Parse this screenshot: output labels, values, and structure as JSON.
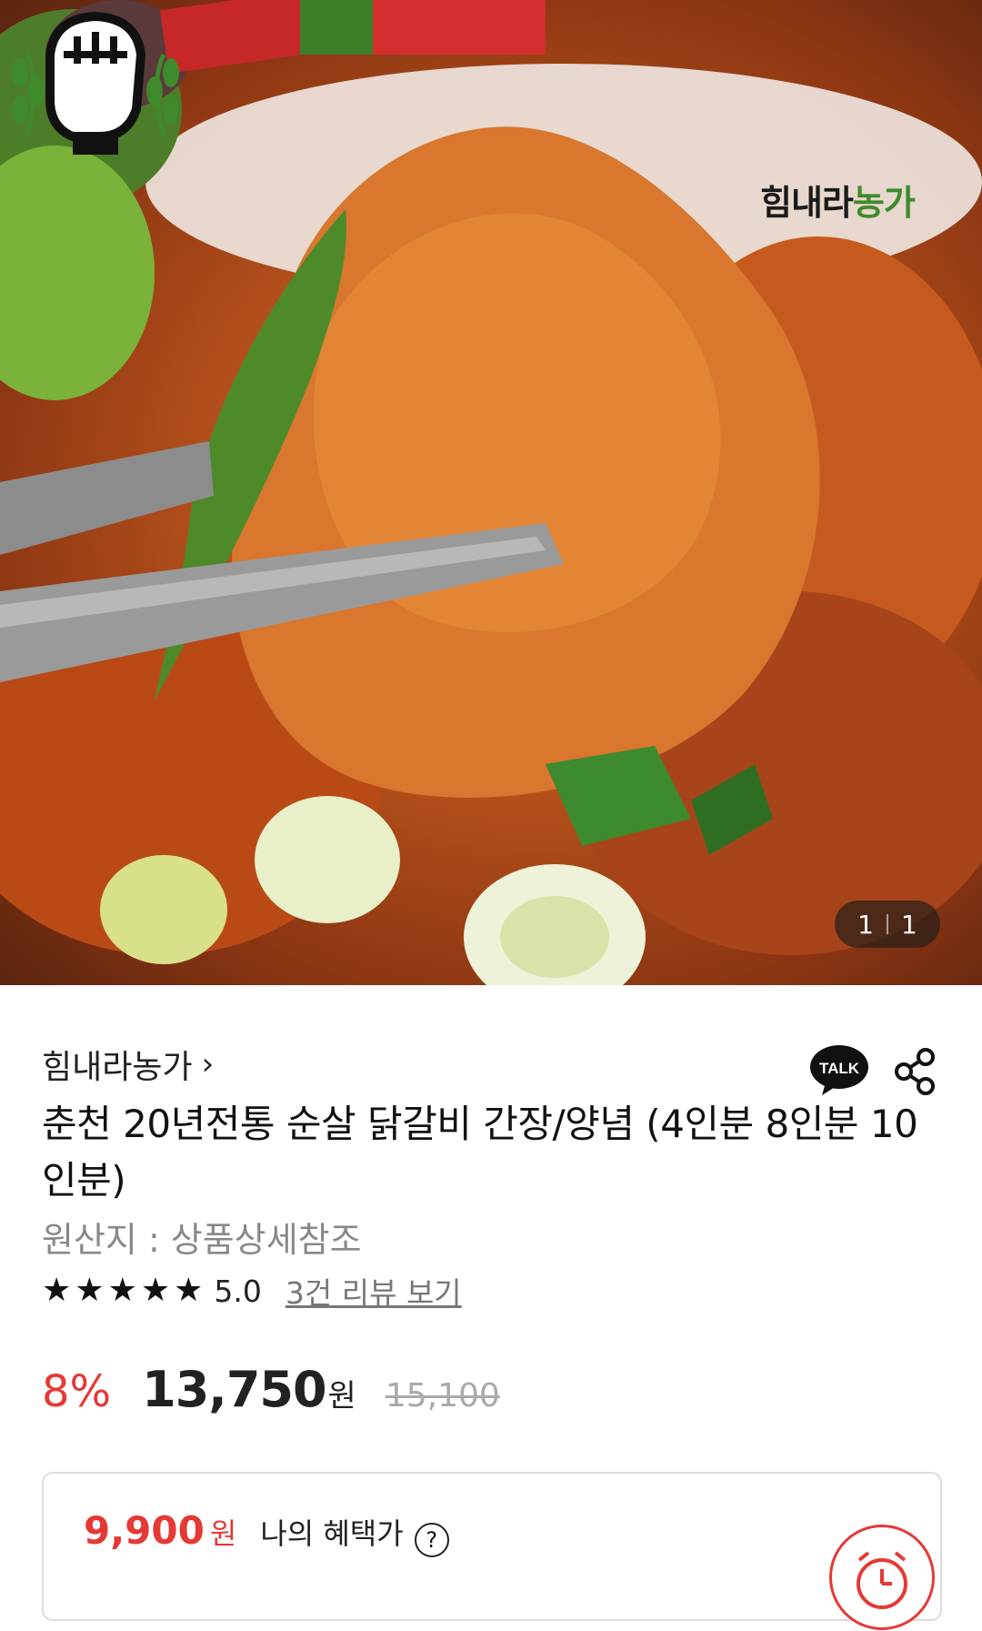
{
  "hero": {
    "counter_current": "1",
    "counter_total": "1",
    "logo_text_dark": "힘내라",
    "logo_text_green": "농가"
  },
  "product": {
    "store_name": "힘내라농가",
    "store_chevron": "›",
    "title": "춘천 20년전통 순살 닭갈비 간장/양념 (4인분 8인분 10인분)",
    "origin": "원산지 : 상품상세참조",
    "rating_score": "5.0",
    "reviews_link": "3건 리뷰 보기",
    "discount": "8%",
    "price": "13,750",
    "currency": "원",
    "original_price": "15,100"
  },
  "benefit": {
    "price": "9,900",
    "currency": "원",
    "label": "나의 혜택가",
    "help": "?"
  },
  "talk_label": "TALK",
  "colors": {
    "accent_red": "#e53935",
    "logo_green": "#3f8a2a"
  },
  "icons": [
    "kakao-talk-icon",
    "share-icon",
    "star-icon",
    "help-icon",
    "alarm-icon"
  ]
}
